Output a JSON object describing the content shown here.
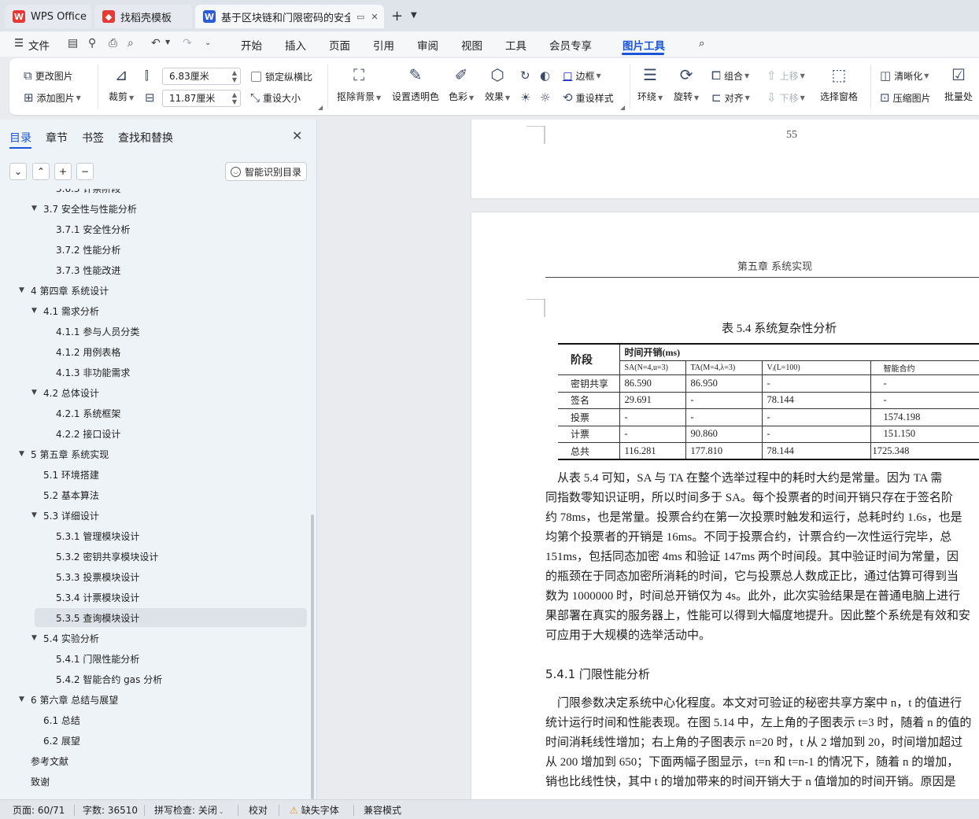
{
  "tabs": [
    {
      "label": "WPS Office",
      "icon": "wps-logo-icon",
      "color": "#e53935"
    },
    {
      "label": "找稻壳模板",
      "icon": "docer-logo-icon",
      "color": "#e53935"
    },
    {
      "label": "基于区块链和门限密码的安全",
      "icon": "writer-logo-icon",
      "color": "#2b5bd7"
    }
  ],
  "menu": [
    "文件",
    "开始",
    "插入",
    "页面",
    "引用",
    "审阅",
    "视图",
    "工具",
    "会员专享",
    "图片工具"
  ],
  "ribbon": {
    "change_image": "更改图片",
    "add_image": "添加图片",
    "crop": "裁剪",
    "width": "6.83厘米",
    "height": "11.87厘米",
    "lock_ratio": "锁定纵横比",
    "reset_size": "重设大小",
    "remove_bg": "抠除背景",
    "set_transparent": "设置透明色",
    "color": "色彩",
    "effect": "效果",
    "border": "边框",
    "reset_style": "重设样式",
    "wrap": "环绕",
    "rotate": "旋转",
    "group": "组合",
    "align": "对齐",
    "bring_forward": "上移",
    "send_backward": "下移",
    "selection_pane": "选择窗格",
    "sharpen": "清晰化",
    "compress": "压缩图片",
    "batch": "批量处"
  },
  "sidebar": {
    "tabs": [
      "目录",
      "章节",
      "书签",
      "查找和替换"
    ],
    "smart_toc": "智能识别目录",
    "toc": [
      {
        "level": 3,
        "text": "3.6.3  计票阶段",
        "arrow": ""
      },
      {
        "level": 2,
        "text": "3.7  安全性与性能分析",
        "arrow": "▼"
      },
      {
        "level": 3,
        "text": "3.7.1  安全性分析",
        "arrow": ""
      },
      {
        "level": 3,
        "text": "3.7.2  性能分析",
        "arrow": ""
      },
      {
        "level": 3,
        "text": "3.7.3  性能改进",
        "arrow": ""
      },
      {
        "level": 1,
        "text": "4  第四章    系统设计",
        "arrow": "▼"
      },
      {
        "level": 2,
        "text": "4.1  需求分析",
        "arrow": "▼"
      },
      {
        "level": 3,
        "text": "4.1.1  参与人员分类",
        "arrow": ""
      },
      {
        "level": 3,
        "text": "4.1.2  用例表格",
        "arrow": ""
      },
      {
        "level": 3,
        "text": "4.1.3  非功能需求",
        "arrow": ""
      },
      {
        "level": 2,
        "text": "4.2  总体设计",
        "arrow": "▼"
      },
      {
        "level": 3,
        "text": "4.2.1  系统框架",
        "arrow": ""
      },
      {
        "level": 3,
        "text": "4.2.2  接口设计",
        "arrow": ""
      },
      {
        "level": 1,
        "text": "5  第五章    系统实现",
        "arrow": "▼"
      },
      {
        "level": 2,
        "text": "5.1  环境搭建",
        "arrow": ""
      },
      {
        "level": 2,
        "text": "5.2  基本算法",
        "arrow": ""
      },
      {
        "level": 2,
        "text": "5.3  详细设计",
        "arrow": "▼"
      },
      {
        "level": 3,
        "text": "5.3.1  管理模块设计",
        "arrow": ""
      },
      {
        "level": 3,
        "text": "5.3.2  密钥共享模块设计",
        "arrow": ""
      },
      {
        "level": 3,
        "text": "5.3.3  投票模块设计",
        "arrow": ""
      },
      {
        "level": 3,
        "text": "5.3.4  计票模块设计",
        "arrow": ""
      },
      {
        "level": 3,
        "text": "5.3.5  查询模块设计",
        "arrow": "",
        "selected": true
      },
      {
        "level": 2,
        "text": "5.4  实验分析",
        "arrow": "▼"
      },
      {
        "level": 3,
        "text": "5.4.1  门限性能分析",
        "arrow": ""
      },
      {
        "level": 3,
        "text": "5.4.2  智能合约 gas 分析",
        "arrow": ""
      },
      {
        "level": 1,
        "text": "6  第六章    总结与展望",
        "arrow": "▼"
      },
      {
        "level": 2,
        "text": "6.1  总结",
        "arrow": ""
      },
      {
        "level": 2,
        "text": "6.2  展望",
        "arrow": ""
      },
      {
        "level": 0,
        "text": "参考文献",
        "arrow": ""
      },
      {
        "level": 0,
        "text": "致谢",
        "arrow": ""
      }
    ]
  },
  "document": {
    "prev_page_number": "55",
    "running_header": "第五章    系统实现",
    "table_caption": "表 5.4 系统复杂性分析",
    "table": {
      "stage_header": "阶段",
      "time_header": "时间开销(ms)",
      "subheaders": [
        "SA(N=4,u=3)",
        "TA(M=4,λ=3)",
        "Vᵢ(L=100)",
        "智能合约"
      ],
      "rows": [
        [
          "密钥共享",
          "86.590",
          "86.950",
          "-",
          "-"
        ],
        [
          "签名",
          "29.691",
          "-",
          "78.144",
          "-"
        ],
        [
          "投票",
          "-",
          "-",
          "-",
          "1574.198"
        ],
        [
          "计票",
          "-",
          "90.860",
          "-",
          "151.150"
        ],
        [
          "总共",
          "116.281",
          "177.810",
          "78.144",
          "1725.348"
        ]
      ]
    },
    "paragraph1": [
      "    从表 5.4 可知，SA 与 TA 在整个选举过程中的耗时大约是常量。因为 TA 需",
      "同指数零知识证明，所以时间多于 SA。每个投票者的时间开销只存在于签名阶",
      "约 78ms，也是常量。投票合约在第一次投票时触发和运行，总耗时约 1.6s，也是",
      "均第个投票者的开销是 16ms。不同于投票合约，计票合约一次性运行完毕，总",
      "151ms，包括同态加密 4ms 和验证 147ms 两个时间段。其中验证时间为常量，因",
      "的瓶颈在于同态加密所消耗的时间，它与投票总人数成正比，通过估算可得到当",
      "数为 1000000 时，时间总开销仅为 4s。此外，此次实验结果是在普通电脑上进行",
      "果部署在真实的服务器上，性能可以得到大幅度地提升。因此整个系统是有效和安",
      "可应用于大规模的选举活动中。"
    ],
    "section_heading": "5.4.1   门限性能分析",
    "paragraph2": [
      "    门限参数决定系统中心化程度。本文对可验证的秘密共享方案中 n，t 的值进行",
      "统计运行时间和性能表现。在图 5.14 中，左上角的子图表示 t=3 时，随着 n 的值的",
      "时间消耗线性增加；右上角的子图表示 n=20 时，t 从 2 增加到 20，时间增加超过",
      "从 200 增加到 650；下面两幅子图显示，t=n 和 t=n-1 的情况下，随着 n 的增加，",
      "销也比线性快，其中 t 的增加带来的时间开销大于 n 值增加的时间开销。原因是"
    ]
  },
  "status": {
    "page": "页面: 60/71",
    "words": "字数: 36510",
    "spell": "拼写检查: 关闭",
    "proof": "校对",
    "missing_font": "缺失字体",
    "compat": "兼容模式"
  }
}
